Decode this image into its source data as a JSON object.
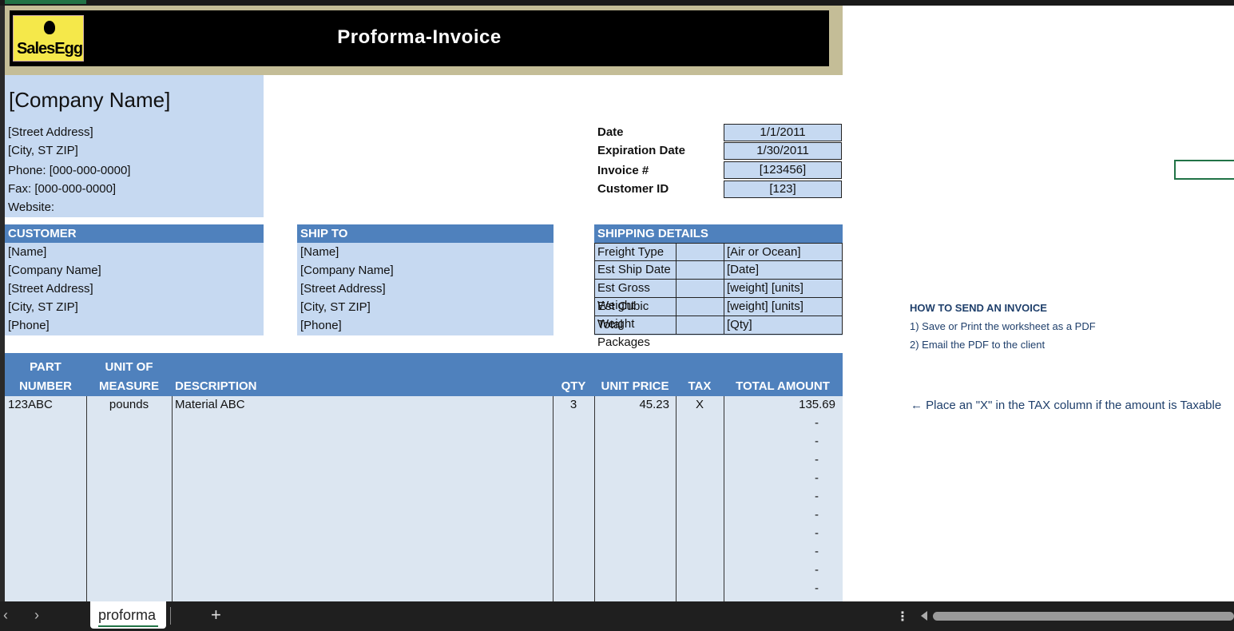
{
  "header": {
    "logo_text": "SalesEgg",
    "title": "Proforma-Invoice"
  },
  "company": {
    "name": "[Company Name]",
    "lines": [
      "[Street Address]",
      "[City, ST  ZIP]",
      "Phone: [000-000-0000]",
      "Fax: [000-000-0000]",
      "Website:"
    ]
  },
  "meta": [
    {
      "label": "Date",
      "value": "1/1/2011"
    },
    {
      "label": "Expiration Date",
      "value": "1/30/2011"
    },
    {
      "label": "Invoice #",
      "value": "[123456]"
    },
    {
      "label": "Customer ID",
      "value": "[123]"
    }
  ],
  "customer": {
    "title": "CUSTOMER",
    "lines": [
      "[Name]",
      "[Company Name]",
      "[Street Address]",
      "[City, ST  ZIP]",
      "[Phone]"
    ]
  },
  "ship_to": {
    "title": "SHIP TO",
    "lines": [
      "[Name]",
      "[Company Name]",
      "[Street Address]",
      "[City, ST  ZIP]",
      "[Phone]"
    ]
  },
  "shipping": {
    "title": "SHIPPING DETAILS",
    "rows": [
      {
        "label": "Freight Type",
        "value": "[Air or Ocean]"
      },
      {
        "label": "Est Ship Date",
        "value": "[Date]"
      },
      {
        "label": "Est Gross Weight",
        "value": "[weight] [units]"
      },
      {
        "label": "Est Cubic Weight",
        "value": "[weight] [units]"
      },
      {
        "label": "Total Packages",
        "value": "[Qty]"
      }
    ]
  },
  "items": {
    "headers": {
      "part_1": "PART",
      "part_2": "NUMBER",
      "unit_1": "UNIT OF",
      "unit_2": "MEASURE",
      "desc": "DESCRIPTION",
      "qty": "QTY",
      "price": "UNIT PRICE",
      "tax": "TAX",
      "total": "TOTAL AMOUNT"
    },
    "rows": [
      {
        "part": "123ABC",
        "unit": "pounds",
        "desc": "Material ABC",
        "qty": "3",
        "price": "45.23",
        "tax": "X",
        "total": "135.69"
      }
    ],
    "empty_total": "-"
  },
  "sidebar": {
    "howto_title": "HOW TO SEND AN INVOICE",
    "howto_1": "1) Save or Print the worksheet as a PDF",
    "howto_2": "2) Email the PDF to the client",
    "tax_note": "← Place an \"X\" in the TAX column if the amount is Taxable"
  },
  "sheet_tab": {
    "name": "proforma",
    "add": "+"
  },
  "colors": {
    "accent": "#217346",
    "header_blue": "#4f81bd",
    "light_blue": "#c6d9f1"
  }
}
